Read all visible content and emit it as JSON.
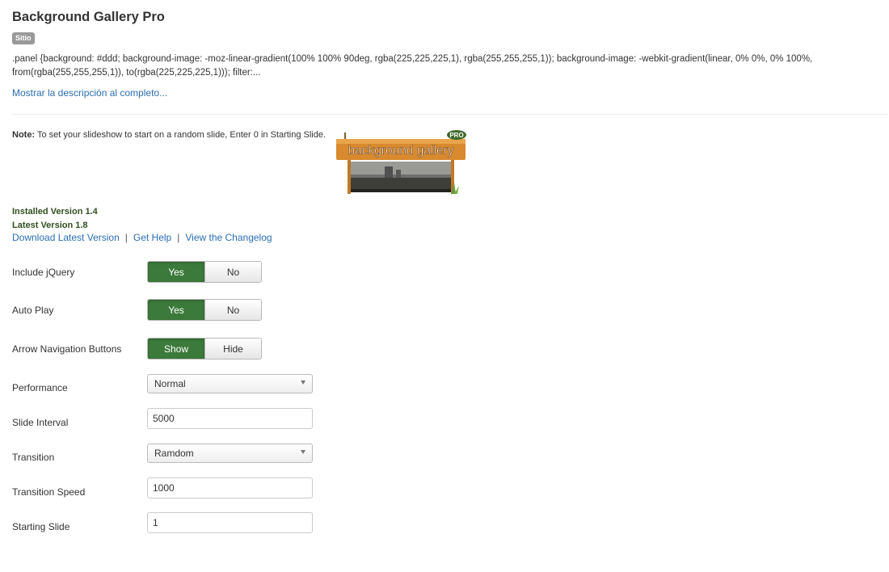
{
  "header": {
    "title": "Background Gallery Pro",
    "badge": "Sitio",
    "description": ".panel {background: #ddd; background-image: -moz-linear-gradient(100% 100% 90deg, rgba(225,225,225,1), rgba(255,255,255,1)); background-image: -webkit-gradient(linear, 0% 0%, 0% 100%, from(rgba(255,255,255,1)), to(rgba(225,225,225,1))); filter:...",
    "more_link": "Mostrar la descripción al completo..."
  },
  "note": {
    "prefix": "Note:",
    "text": " To set your slideshow to start on a random slide, Enter 0 in Starting Slide."
  },
  "logo": {
    "text": "background gallery",
    "pro": "PRO"
  },
  "versions": {
    "installed": "Installed Version 1.4",
    "latest": "Latest Version 1.8"
  },
  "links": {
    "download": "Download Latest Version",
    "sep": "|",
    "help": "Get Help",
    "changelog": "View the Changelog"
  },
  "form": {
    "include_jquery": {
      "label": "Include jQuery",
      "on": "Yes",
      "off": "No"
    },
    "auto_play": {
      "label": "Auto Play",
      "on": "Yes",
      "off": "No"
    },
    "arrow_nav": {
      "label": "Arrow Navigation Buttons",
      "on": "Show",
      "off": "Hide"
    },
    "performance": {
      "label": "Performance",
      "value": "Normal"
    },
    "slide_interval": {
      "label": "Slide Interval",
      "value": "5000"
    },
    "transition": {
      "label": "Transition",
      "value": "Ramdom"
    },
    "transition_speed": {
      "label": "Transition Speed",
      "value": "1000"
    },
    "starting_slide": {
      "label": "Starting Slide",
      "value": "1"
    }
  },
  "colors": {
    "accent_green": "#3c7a3c",
    "link_blue": "#2a6db0",
    "badge_gray": "#999999"
  },
  "icons": {
    "caret": "chevron-down-icon"
  }
}
